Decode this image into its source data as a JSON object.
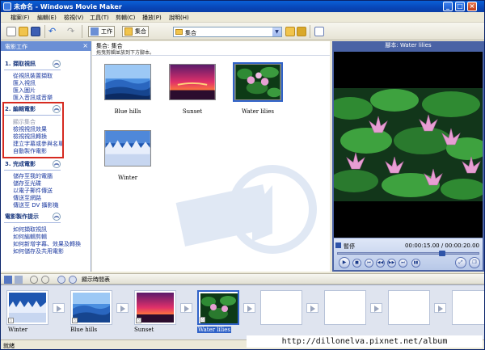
{
  "window": {
    "title": "未命名 - Windows Movie Maker",
    "controls": [
      "_",
      "□",
      "×"
    ]
  },
  "menu": [
    "檔案(F)",
    "編輯(E)",
    "檢視(V)",
    "工具(T)",
    "剪輯(C)",
    "播放(P)",
    "說明(H)"
  ],
  "toolbar": {
    "tasks_label": "工作",
    "collections_label": "集合",
    "collection_value": "集合"
  },
  "taskpane": {
    "header": "電影工作",
    "close": "×",
    "sections": [
      {
        "title": "1. 擷取視訊",
        "chevron": "︽",
        "links": [
          "從視訊裝置擷取",
          "匯入視訊",
          "匯入圖片",
          "匯入音訊或音樂"
        ]
      },
      {
        "title": "2. 編輯電影",
        "chevron": "︽",
        "links": [
          "顯示集合",
          "檢視視訊效果",
          "檢視視訊轉換",
          "建立字幕或參與名單",
          "自動製作電影"
        ]
      },
      {
        "title": "3. 完成電影",
        "chevron": "︽",
        "links": [
          "儲存至我的電腦",
          "儲存至光碟",
          "以電子郵件傳送",
          "傳送至網路",
          "傳送至 DV 攝影機"
        ]
      },
      {
        "title": "電影製作提示",
        "chevron": "︽",
        "links": [
          "如何擷取視訊",
          "如何編輯剪輯",
          "如何新增字幕、效果及轉換",
          "如何儲存及共用電影"
        ]
      }
    ]
  },
  "collection": {
    "title": "集合: 集合",
    "hint": "拖曳剪輯並放到下方腳本。",
    "clips": [
      {
        "name": "Blue hills"
      },
      {
        "name": "Sunset"
      },
      {
        "name": "Water lilies"
      },
      {
        "name": "Winter"
      }
    ]
  },
  "preview": {
    "title": "腳本: Water lilies",
    "status": "暫停",
    "time": "00:00:15.00 / 00:00:20.00",
    "progress": 0.75,
    "buttons": [
      "▶",
      "■",
      "⏮",
      "◀◀",
      "▶▶",
      "⏭",
      "▮▮",
      "⤢",
      "❐"
    ]
  },
  "storyboard": {
    "timeline_toggle": "顯示時間表",
    "clips": [
      {
        "name": "Winter"
      },
      {
        "name": "Blue hills"
      },
      {
        "name": "Sunset"
      },
      {
        "name": "Water lilies"
      }
    ]
  },
  "status_text": "就緒",
  "watermark": "http://dillonelva.pixnet.net/album",
  "colors": {
    "title_bar": "#0a4fc6",
    "task_link": "#1c3aa0",
    "highlight": "#d62a20",
    "selection": "#3062c8"
  }
}
